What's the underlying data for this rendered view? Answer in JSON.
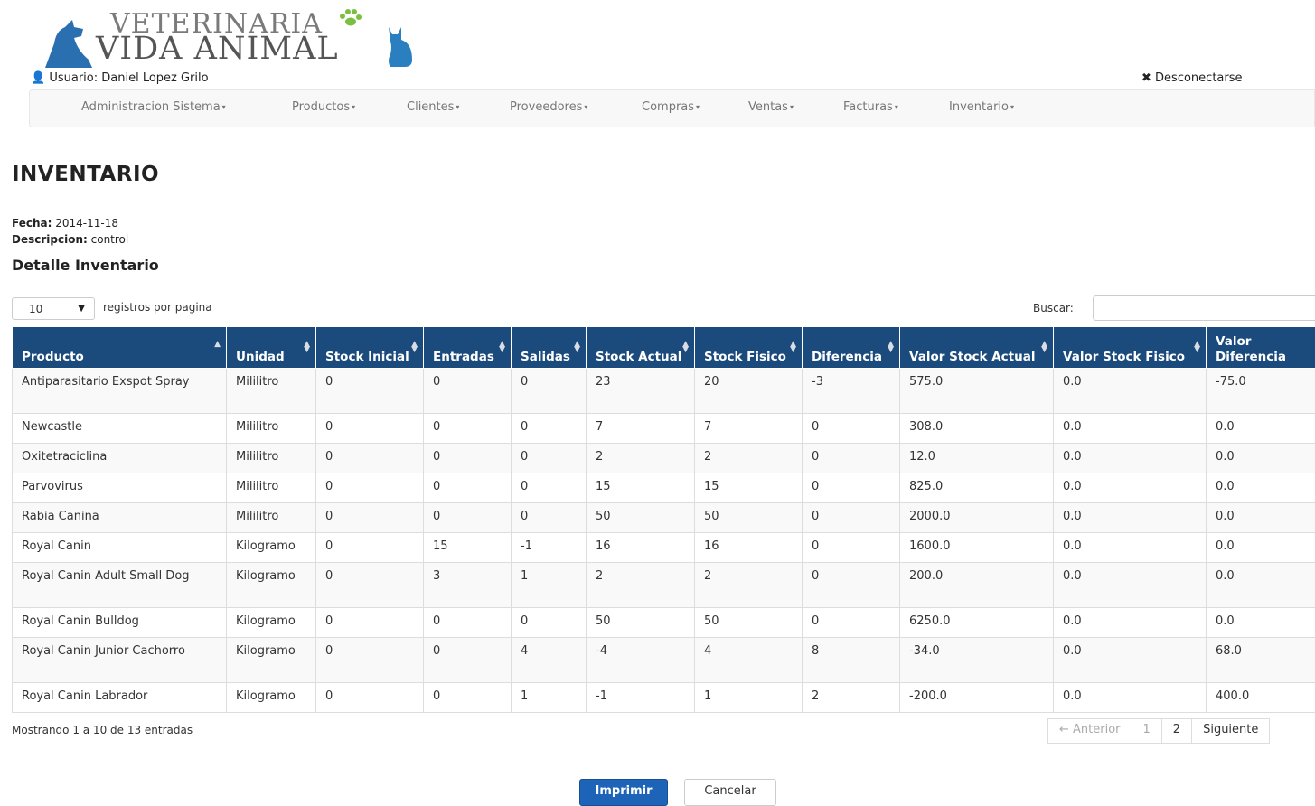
{
  "header": {
    "logo_line1": "VETERINARIA",
    "logo_line2": "VIDA ANIMAL",
    "user_label": "Usuario: Daniel Lopez Grilo",
    "logout_label": "Desconectarse"
  },
  "nav": {
    "items": [
      "Administracion Sistema",
      "Productos",
      "Clientes",
      "Proveedores",
      "Compras",
      "Ventas",
      "Facturas",
      "Inventario"
    ]
  },
  "page": {
    "title": "INVENTARIO",
    "fecha_label": "Fecha:",
    "fecha_value": "2014-11-18",
    "descripcion_label": "Descripcion:",
    "descripcion_value": "control",
    "subtitle": "Detalle Inventario"
  },
  "table_controls": {
    "length_value": "10",
    "length_label": "registros por pagina",
    "search_label": "Buscar:",
    "search_value": ""
  },
  "table": {
    "columns": [
      "Producto",
      "Unidad",
      "Stock Inicial",
      "Entradas",
      "Salidas",
      "Stock Actual",
      "Stock Fisico",
      "Diferencia",
      "Valor Stock Actual",
      "Valor Stock Fisico",
      "Valor Diferencia"
    ],
    "rows": [
      [
        "Antiparasitario Exspot Spray",
        "Mililitro",
        "0",
        "0",
        "0",
        "23",
        "20",
        "-3",
        "575.0",
        "0.0",
        "-75.0"
      ],
      [
        "Newcastle",
        "Mililitro",
        "0",
        "0",
        "0",
        "7",
        "7",
        "0",
        "308.0",
        "0.0",
        "0.0"
      ],
      [
        "Oxitetraciclina",
        "Mililitro",
        "0",
        "0",
        "0",
        "2",
        "2",
        "0",
        "12.0",
        "0.0",
        "0.0"
      ],
      [
        "Parvovirus",
        "Mililitro",
        "0",
        "0",
        "0",
        "15",
        "15",
        "0",
        "825.0",
        "0.0",
        "0.0"
      ],
      [
        "Rabia Canina",
        "Mililitro",
        "0",
        "0",
        "0",
        "50",
        "50",
        "0",
        "2000.0",
        "0.0",
        "0.0"
      ],
      [
        "Royal Canin",
        "Kilogramo",
        "0",
        "15",
        "-1",
        "16",
        "16",
        "0",
        "1600.0",
        "0.0",
        "0.0"
      ],
      [
        "Royal Canin Adult Small Dog",
        "Kilogramo",
        "0",
        "3",
        "1",
        "2",
        "2",
        "0",
        "200.0",
        "0.0",
        "0.0"
      ],
      [
        "Royal Canin Bulldog",
        "Kilogramo",
        "0",
        "0",
        "0",
        "50",
        "50",
        "0",
        "6250.0",
        "0.0",
        "0.0"
      ],
      [
        "Royal Canin Junior Cachorro",
        "Kilogramo",
        "0",
        "0",
        "4",
        "-4",
        "4",
        "8",
        "-34.0",
        "0.0",
        "68.0"
      ],
      [
        "Royal Canin Labrador",
        "Kilogramo",
        "0",
        "0",
        "1",
        "-1",
        "1",
        "2",
        "-200.0",
        "0.0",
        "400.0"
      ]
    ]
  },
  "footer": {
    "info": "Mostrando 1 a 10 de 13 entradas",
    "prev": "← Anterior",
    "pages": [
      "1",
      "2"
    ],
    "next": "Siguiente"
  },
  "actions": {
    "print": "Imprimir",
    "cancel": "Cancelar"
  },
  "colors": {
    "table_header": "#1b4a7c",
    "primary_button": "#1d63b8",
    "logo_blue": "#2a7fc1",
    "logo_green": "#7bbf3f"
  }
}
